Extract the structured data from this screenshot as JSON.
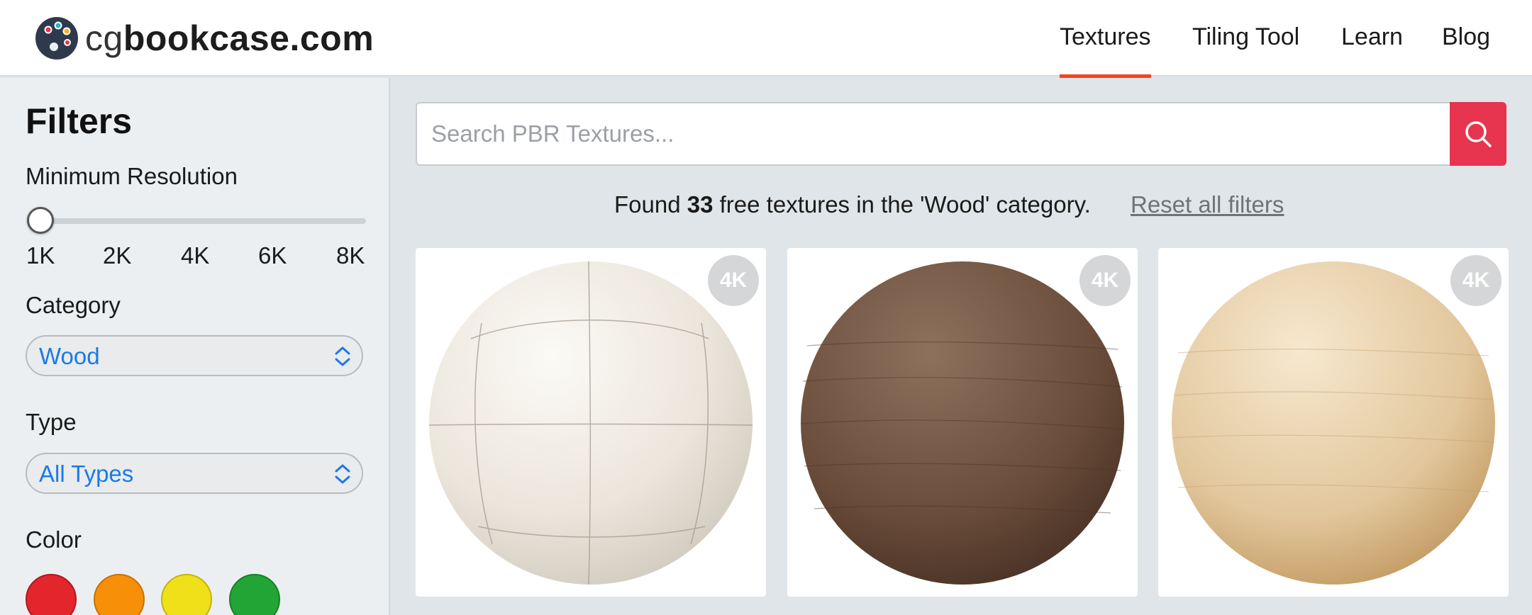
{
  "header": {
    "logo": {
      "prefix": "cg",
      "main": "bookcase.com"
    },
    "nav": [
      {
        "label": "Textures",
        "active": true
      },
      {
        "label": "Tiling Tool",
        "active": false
      },
      {
        "label": "Learn",
        "active": false
      },
      {
        "label": "Blog",
        "active": false
      }
    ],
    "accent_color": "#ef4523"
  },
  "sidebar": {
    "title": "Filters",
    "resolution": {
      "label": "Minimum Resolution",
      "options": [
        "1K",
        "2K",
        "4K",
        "6K",
        "8K"
      ],
      "selected": "1K"
    },
    "category": {
      "label": "Category",
      "value": "Wood"
    },
    "type": {
      "label": "Type",
      "value": "All Types"
    },
    "color": {
      "label": "Color",
      "swatches": [
        {
          "name": "red",
          "hex": "#e3252c"
        },
        {
          "name": "orange",
          "hex": "#f79008"
        },
        {
          "name": "yellow",
          "hex": "#efe01a"
        },
        {
          "name": "green",
          "hex": "#22a534"
        }
      ]
    }
  },
  "search": {
    "placeholder": "Search PBR Textures...",
    "button_color": "#e7344f",
    "button_icon": "search-icon"
  },
  "results": {
    "prefix": "Found ",
    "count": "33",
    "suffix": " free textures in the 'Wood' category.",
    "reset_label": "Reset all filters"
  },
  "textures": [
    {
      "badge": "4K",
      "colors": [
        "#fbfaf6",
        "#ece6dc",
        "#c9c2b6"
      ],
      "tiled": true
    },
    {
      "badge": "4K",
      "colors": [
        "#8d715d",
        "#6a4c3a",
        "#3f2a1f"
      ],
      "tiled": false
    },
    {
      "badge": "4K",
      "colors": [
        "#f6e8cf",
        "#e2c79c",
        "#b98d52"
      ],
      "tiled": false
    }
  ]
}
